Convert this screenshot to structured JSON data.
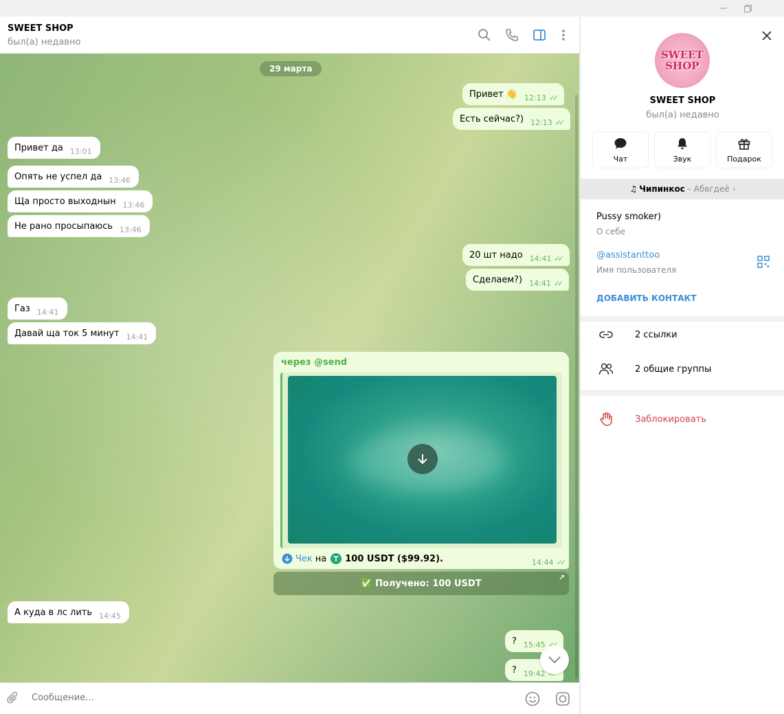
{
  "colors": {
    "accent": "#3a8fd6",
    "out_bubble": "#effdde",
    "check": "#5fbe5f",
    "danger": "#d14343"
  },
  "chat": {
    "title": "SWEET SHOP",
    "status": "был(а) недавно",
    "date_pill": "29 марта",
    "messages": [
      {
        "dir": "out",
        "text": "Привет 👋",
        "time": "12:13"
      },
      {
        "dir": "out",
        "text": "Есть сейчас?)",
        "time": "12:13"
      },
      {
        "dir": "in",
        "text": "Привет да",
        "time": "13:01"
      },
      {
        "dir": "in",
        "text": "Опять не успел да",
        "time": "13:46"
      },
      {
        "dir": "in",
        "text": "Ща просто выходнын",
        "time": "13:46"
      },
      {
        "dir": "in",
        "text": "Не рано просыпаюсь",
        "time": "13:46"
      },
      {
        "dir": "out",
        "text": "20 шт надо",
        "time": "14:41"
      },
      {
        "dir": "out",
        "text": "Сделаем?)",
        "time": "14:41"
      },
      {
        "dir": "in",
        "text": "Газ",
        "time": "14:41"
      },
      {
        "dir": "in",
        "text": "Давай ща ток 5 минут",
        "time": "14:41"
      },
      {
        "dir": "in",
        "text": "А куда в лс лить",
        "time": "14:45"
      },
      {
        "dir": "out",
        "text": "?",
        "time": "15:45"
      },
      {
        "dir": "out",
        "text": "?",
        "time": "19:42"
      }
    ],
    "check_card": {
      "via": "через @send",
      "check_label": "Чек",
      "on": "на",
      "amount": "100 USDT ($99.92).",
      "time": "14:44",
      "received": "✅ Получено: 100 USDT"
    },
    "composer_placeholder": "Сообщение..."
  },
  "profile": {
    "avatar_line1": "SWEET",
    "avatar_line2": "SHOP",
    "name": "SWEET SHOP",
    "status": "был(а) недавно",
    "actions": [
      {
        "label": "Чат",
        "icon": "chat-icon"
      },
      {
        "label": "Звук",
        "icon": "bell-icon"
      },
      {
        "label": "Подарок",
        "icon": "gift-icon"
      }
    ],
    "music": {
      "note": "♫",
      "song": "Чипинкос",
      "artist": "– Абвгдеё",
      "chevron": "›"
    },
    "bio": "Pussy smoker)",
    "bio_caption": "О себе",
    "username": "@assistanttoo",
    "username_caption": "Имя пользователя",
    "add_contact": "ДОБАВИТЬ КОНТАКТ",
    "links": "2 ссылки",
    "groups": "2 общие группы",
    "block": "Заблокировать"
  }
}
